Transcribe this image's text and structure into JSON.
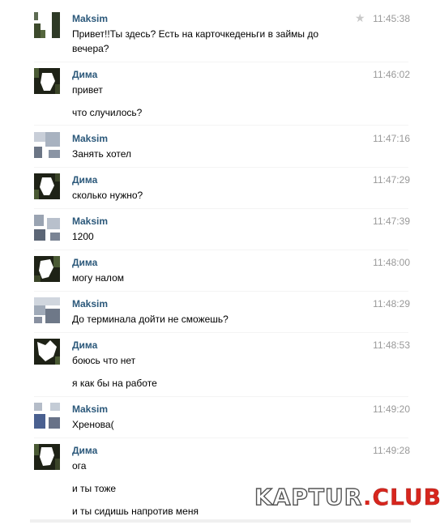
{
  "messages": [
    {
      "author": "Maksim",
      "time": "11:45:38",
      "starred": true,
      "lines": [
        "Привет!!Ты здесь? Есть на карточкеденьги в займы до",
        "вечера?"
      ]
    },
    {
      "author": "Дима",
      "time": "11:46:02",
      "lines": [
        "привет",
        "что случилось?"
      ]
    },
    {
      "author": "Maksim",
      "time": "11:47:16",
      "lines": [
        "Занять хотел"
      ]
    },
    {
      "author": "Дима",
      "time": "11:47:29",
      "lines": [
        "сколько нужно?"
      ]
    },
    {
      "author": "Maksim",
      "time": "11:47:39",
      "lines": [
        "1200"
      ]
    },
    {
      "author": "Дима",
      "time": "11:48:00",
      "lines": [
        "могу налом"
      ]
    },
    {
      "author": "Maksim",
      "time": "11:48:29",
      "lines": [
        "До терминала дойти не сможешь?"
      ]
    },
    {
      "author": "Дима",
      "time": "11:48:53",
      "lines": [
        "боюсь что нет",
        "я как бы на работе"
      ]
    },
    {
      "author": "Maksim",
      "time": "11:49:20",
      "lines": [
        "Хренова("
      ]
    },
    {
      "author": "Дима",
      "time": "11:49:28",
      "lines": [
        "ога",
        "и ты тоже",
        "и ты сидишь напротив меня"
      ]
    }
  ],
  "icons": {
    "star": "star-icon",
    "avatar_maksim": "avatar-maksim",
    "avatar_dima": "avatar-dima"
  },
  "colors": {
    "author": "#2b587a",
    "time": "#999999",
    "watermark_accent": "#d7261e"
  },
  "watermark": {
    "part1": "KAPTUR",
    "dot": ".",
    "part2": "CLUB"
  }
}
